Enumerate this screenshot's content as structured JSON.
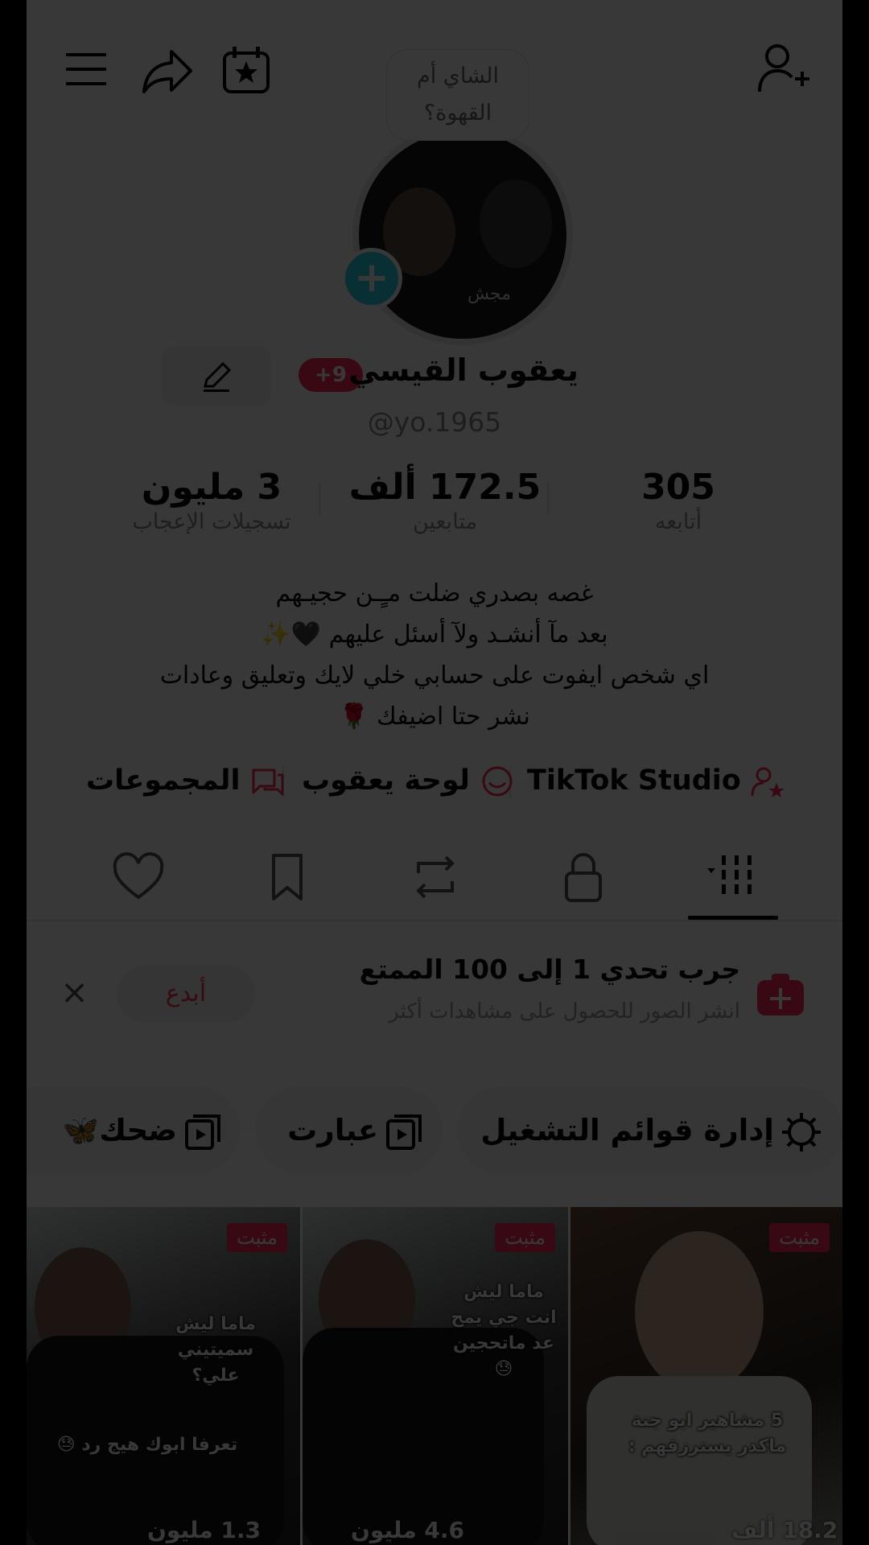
{
  "story_bubble": {
    "line1": "الشاي أم",
    "line2": "القهوة؟"
  },
  "avatar_caption": "مجش",
  "profile": {
    "name": "يعقوب القيسي",
    "badge": "+9",
    "handle": "@yo.1965"
  },
  "stats": [
    {
      "value": "305",
      "label": "أتابعه"
    },
    {
      "value": "172.5 ألف",
      "label": "متابعين"
    },
    {
      "value": "3 مليون",
      "label": "تسجيلات الإعجاب"
    }
  ],
  "bio": [
    "غصه بصدري ضلت مـٍـن حجيـهم",
    "بعد مآ أنشـد ولآ أسئل عليهم 🖤✨",
    "اي شخص ايفوت على حسابي خلي لايك وتعليق وعادات",
    "نشر حتا اضيفك 🌹"
  ],
  "links": [
    {
      "label": "TikTok Studio",
      "icon": "person-star-icon"
    },
    {
      "label": "لوحة يعقوب",
      "icon": "chat-face-icon"
    },
    {
      "label": "المجموعات",
      "icon": "group-chat-icon"
    }
  ],
  "promo": {
    "title": "جرب تحدي 1 إلى 100 الممتع",
    "subtitle": "انشر الصور للحصول على مشاهدات أكثر",
    "button": "أبدع",
    "close": "×"
  },
  "chips": [
    {
      "label": "إدارة قوائم التشغيل",
      "icon": "gear-icon"
    },
    {
      "label": "عبارت",
      "icon": "playlist-icon"
    },
    {
      "label": "ضحك",
      "icon": "playlist-icon",
      "emoji": "🦋"
    }
  ],
  "videos": [
    {
      "pinned": "مثبت",
      "caption": "5 مشاهير ابو جنة ماكدر يسترزقهم :",
      "views": "18.2 ألف"
    },
    {
      "pinned": "مثبت",
      "caption": "ماما ليش انت جي يمح عد ماتحجين 😓",
      "views": "4.6 مليون"
    },
    {
      "pinned": "مثبت",
      "caption": "ماما ليش سميتيني علي؟",
      "caption2": "تعرفا ابوك هيج رد 😓",
      "views": "1.3 مليون"
    }
  ],
  "colors": {
    "accent": "#fe2c55",
    "plus": "#20d5ec",
    "overlay": "rgba(0,0,0,0.78)"
  }
}
